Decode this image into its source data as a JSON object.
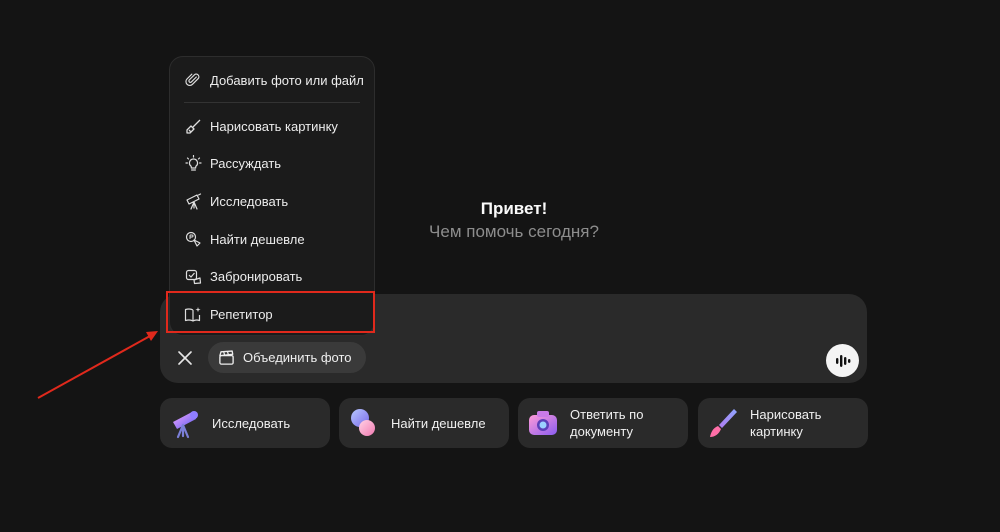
{
  "greeting": {
    "title": "Привет!",
    "subtitle": "Чем помочь сегодня?"
  },
  "menu": {
    "items": [
      {
        "label": "Добавить фото или файл",
        "icon": "paperclip-icon"
      },
      {
        "label": "Нарисовать картинку",
        "icon": "brush-icon"
      },
      {
        "label": "Рассуждать",
        "icon": "lightbulb-icon"
      },
      {
        "label": "Исследовать",
        "icon": "telescope-icon"
      },
      {
        "label": "Найти дешевле",
        "icon": "price-tag-icon"
      },
      {
        "label": "Забронировать",
        "icon": "booking-icon"
      },
      {
        "label": "Репетитор",
        "icon": "book-sparkle-icon"
      }
    ]
  },
  "composer": {
    "chip_label": "Объединить фото",
    "chip_icon": "clapperboard-icon",
    "close_icon": "close-icon",
    "voice_icon": "waveform-icon"
  },
  "suggestions": [
    {
      "label": "Исследовать",
      "icon": "telescope-3d-icon"
    },
    {
      "label": "Найти дешевле",
      "icon": "coins-3d-icon"
    },
    {
      "label": "Ответить по документу",
      "icon": "camera-3d-icon"
    },
    {
      "label": "Нарисовать картинку",
      "icon": "paintbrush-3d-icon"
    }
  ],
  "colors": {
    "background": "#141414",
    "surface": "#2a2a2a",
    "highlight": "#e0291c",
    "text": "#f2f2f2",
    "muted": "#8d8d8d"
  }
}
